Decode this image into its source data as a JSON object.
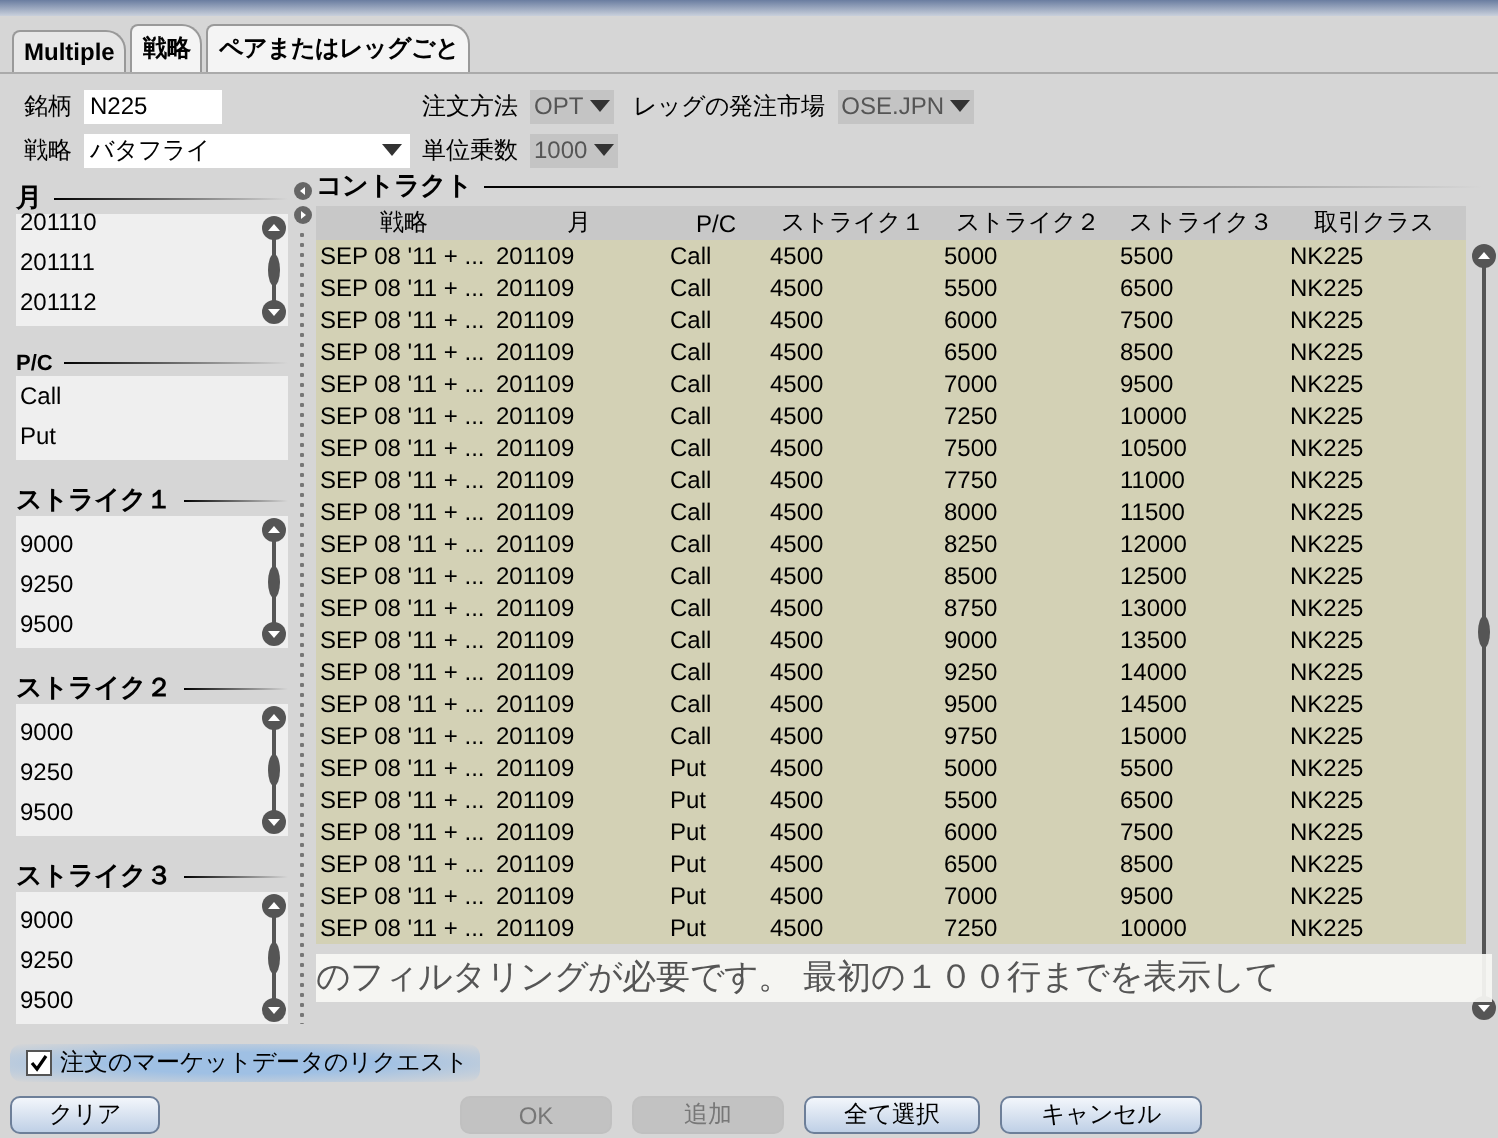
{
  "tabs": [
    {
      "label": "Multiple",
      "selected": true
    },
    {
      "label": "戦略",
      "selected": false
    },
    {
      "label": "ペアまたはレッグごと",
      "selected": false
    }
  ],
  "form": {
    "symbol_label": "銘柄",
    "symbol_value": "N225",
    "strategy_label": "戦略",
    "strategy_value": "バタフライ",
    "order_method_label": "注文方法",
    "order_method_value": "OPT",
    "leg_market_label": "レッグの発注市場",
    "leg_market_value": "OSE.JPN",
    "multiplier_label": "単位乗数",
    "multiplier_value": "1000"
  },
  "filters": [
    {
      "title": "月",
      "scroll": true,
      "items": [
        "201110",
        "201111",
        "201112"
      ]
    },
    {
      "title": "P/C",
      "scroll": false,
      "items": [
        "Call",
        "Put"
      ]
    },
    {
      "title": "ストライク１",
      "scroll": true,
      "items": [
        "9000",
        "9250",
        "9500"
      ]
    },
    {
      "title": "ストライク２",
      "scroll": true,
      "items": [
        "9000",
        "9250",
        "9500"
      ]
    },
    {
      "title": "ストライク３",
      "scroll": true,
      "items": [
        "9000",
        "9250",
        "9500"
      ]
    }
  ],
  "contracts": {
    "title": "コントラクト",
    "columns": [
      "戦略",
      "月",
      "P/C",
      "ストライク１",
      "ストライク２",
      "ストライク３",
      "取引クラス"
    ],
    "rows": [
      [
        "SEP 08 '11 + ...",
        "201109",
        "Call",
        "4500",
        "5000",
        "5500",
        "NK225"
      ],
      [
        "SEP 08 '11 + ...",
        "201109",
        "Call",
        "4500",
        "5500",
        "6500",
        "NK225"
      ],
      [
        "SEP 08 '11 + ...",
        "201109",
        "Call",
        "4500",
        "6000",
        "7500",
        "NK225"
      ],
      [
        "SEP 08 '11 + ...",
        "201109",
        "Call",
        "4500",
        "6500",
        "8500",
        "NK225"
      ],
      [
        "SEP 08 '11 + ...",
        "201109",
        "Call",
        "4500",
        "7000",
        "9500",
        "NK225"
      ],
      [
        "SEP 08 '11 + ...",
        "201109",
        "Call",
        "4500",
        "7250",
        "10000",
        "NK225"
      ],
      [
        "SEP 08 '11 + ...",
        "201109",
        "Call",
        "4500",
        "7500",
        "10500",
        "NK225"
      ],
      [
        "SEP 08 '11 + ...",
        "201109",
        "Call",
        "4500",
        "7750",
        "11000",
        "NK225"
      ],
      [
        "SEP 08 '11 + ...",
        "201109",
        "Call",
        "4500",
        "8000",
        "11500",
        "NK225"
      ],
      [
        "SEP 08 '11 + ...",
        "201109",
        "Call",
        "4500",
        "8250",
        "12000",
        "NK225"
      ],
      [
        "SEP 08 '11 + ...",
        "201109",
        "Call",
        "4500",
        "8500",
        "12500",
        "NK225"
      ],
      [
        "SEP 08 '11 + ...",
        "201109",
        "Call",
        "4500",
        "8750",
        "13000",
        "NK225"
      ],
      [
        "SEP 08 '11 + ...",
        "201109",
        "Call",
        "4500",
        "9000",
        "13500",
        "NK225"
      ],
      [
        "SEP 08 '11 + ...",
        "201109",
        "Call",
        "4500",
        "9250",
        "14000",
        "NK225"
      ],
      [
        "SEP 08 '11 + ...",
        "201109",
        "Call",
        "4500",
        "9500",
        "14500",
        "NK225"
      ],
      [
        "SEP 08 '11 + ...",
        "201109",
        "Call",
        "4500",
        "9750",
        "15000",
        "NK225"
      ],
      [
        "SEP 08 '11 + ...",
        "201109",
        "Put",
        "4500",
        "5000",
        "5500",
        "NK225"
      ],
      [
        "SEP 08 '11 + ...",
        "201109",
        "Put",
        "4500",
        "5500",
        "6500",
        "NK225"
      ],
      [
        "SEP 08 '11 + ...",
        "201109",
        "Put",
        "4500",
        "6000",
        "7500",
        "NK225"
      ],
      [
        "SEP 08 '11 + ...",
        "201109",
        "Put",
        "4500",
        "6500",
        "8500",
        "NK225"
      ],
      [
        "SEP 08 '11 + ...",
        "201109",
        "Put",
        "4500",
        "7000",
        "9500",
        "NK225"
      ],
      [
        "SEP 08 '11 + ...",
        "201109",
        "Put",
        "4500",
        "7250",
        "10000",
        "NK225"
      ]
    ],
    "notice": "のフィルタリングが必要です。 最初の１００行までを表示して"
  },
  "market_data_request": {
    "label": "注文のマーケットデータのリクエスト",
    "checked": true
  },
  "buttons": [
    {
      "label": "クリア",
      "disabled": false
    },
    {
      "label": "OK",
      "disabled": true
    },
    {
      "label": "追加",
      "disabled": true
    },
    {
      "label": "全て選択",
      "disabled": false
    },
    {
      "label": "キャンセル",
      "disabled": false
    }
  ]
}
